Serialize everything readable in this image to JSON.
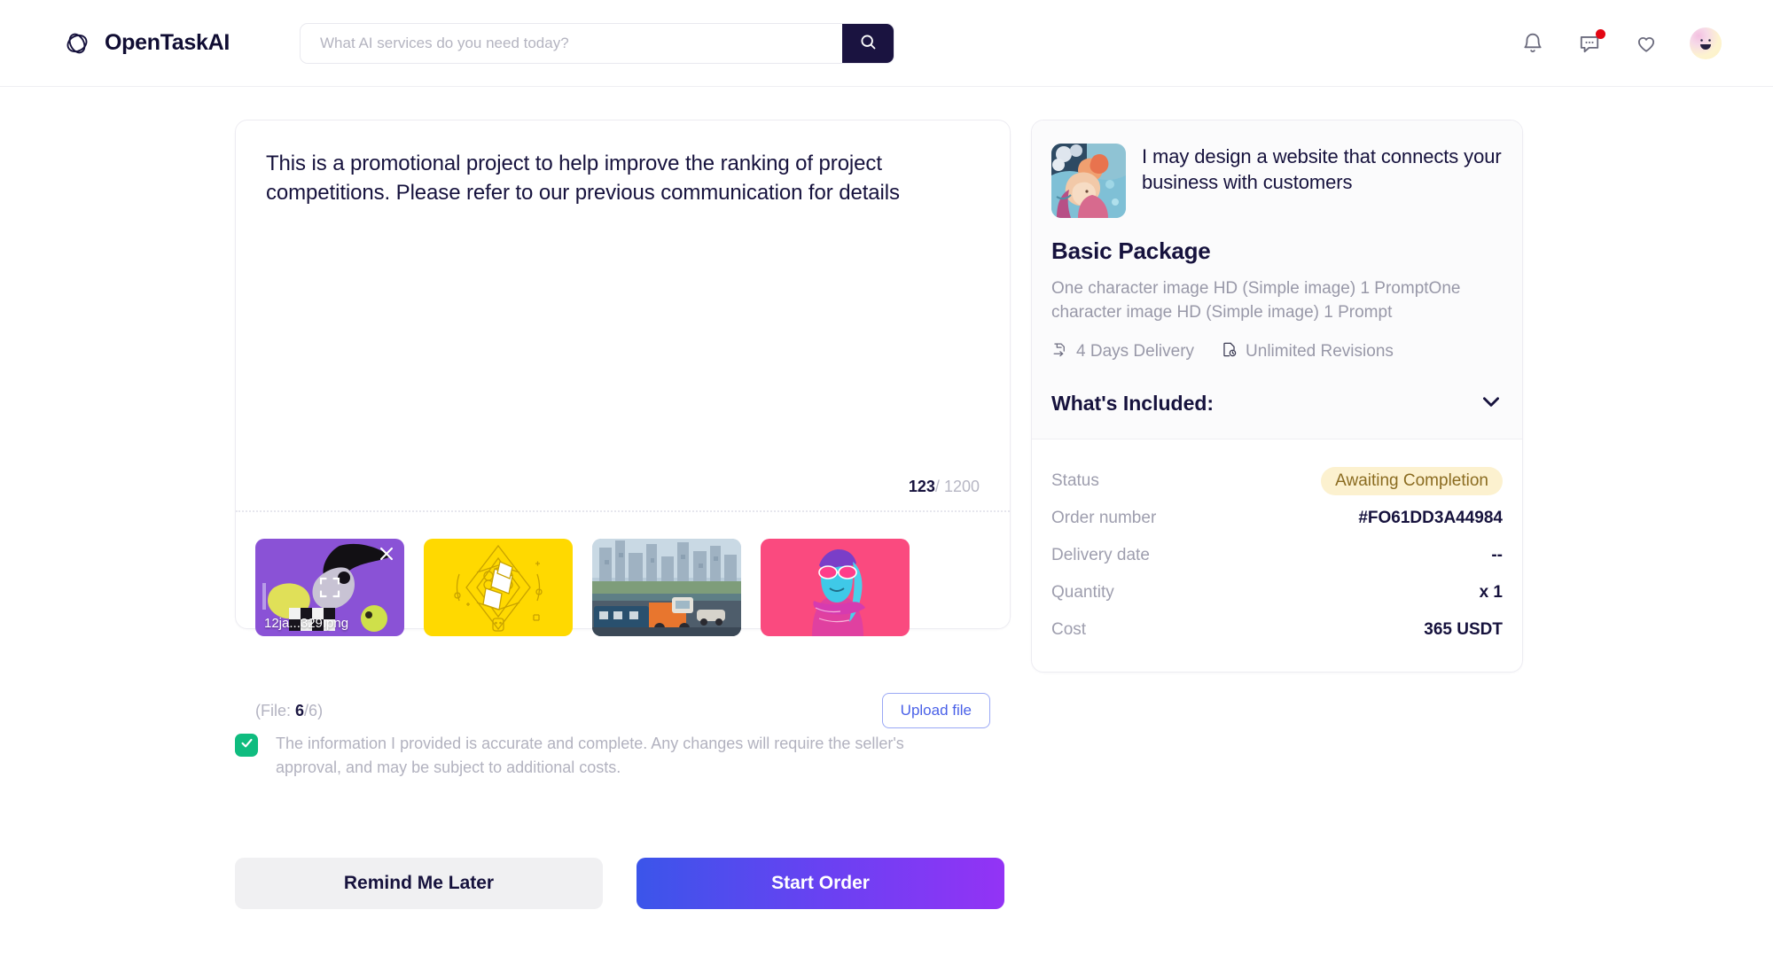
{
  "header": {
    "brand": "OpenTaskAI",
    "logo_icon": "hexagon-loop-logo-icon",
    "search": {
      "placeholder": "What AI services do you need today?",
      "value": "",
      "button_icon": "search-icon"
    },
    "icons": {
      "notifications": "bell-icon",
      "messages": "chat-bubble-icon",
      "favorites": "heart-icon",
      "avatar": "user-avatar-smiley"
    },
    "message_badge": true,
    "badge_color": "#e30613"
  },
  "brief": {
    "text": "This is a promotional project to help improve the ranking of project competitions. Please refer to our previous communication for details",
    "char_count": "123",
    "char_limit_separator": "/",
    "char_limit": "1200"
  },
  "attachments": {
    "files": [
      {
        "name": "12ja...329.png",
        "selected": true,
        "close_icon": "close-x-icon",
        "expand_icon": "expand-icon",
        "theme": "purple-chess-illustration"
      },
      {
        "name": "",
        "selected": false,
        "theme": "yellow-diamond-line-art"
      },
      {
        "name": "",
        "selected": false,
        "theme": "city-street-painting"
      },
      {
        "name": "",
        "selected": false,
        "theme": "pink-portrait-neon"
      }
    ],
    "count_prefix": "(File:",
    "count_current": "6",
    "count_sep": "/",
    "count_max": "6",
    "count_suffix": ")",
    "upload_label": "Upload file"
  },
  "consent": {
    "checked": true,
    "check_icon": "checkmark-icon",
    "check_color": "#0fbc7f",
    "text": "The information I provided is accurate and complete. Any changes will require the seller's approval, and may be subject to additional costs."
  },
  "actions": {
    "secondary_label": "Remind Me Later",
    "primary_label": "Start Order",
    "primary_gradient_from": "#3b55ea",
    "primary_gradient_to": "#9333f5"
  },
  "package": {
    "thumbnail": "fantasy-portrait-artwork",
    "service_title": "I may design a website that connects your business with customers",
    "name": "Basic Package",
    "description": "One character image HD (Simple image) 1 PromptOne character image HD (Simple image) 1 Prompt",
    "delivery_icon": "delivery-time-icon",
    "delivery": "4 Days Delivery",
    "revisions_icon": "revision-file-icon",
    "revisions": "Unlimited Revisions",
    "included_label": "What's Included:",
    "included_expanded": false,
    "included_chevron": "chevron-down-icon"
  },
  "order": {
    "rows": [
      {
        "label": "Status",
        "value": "Awaiting Completion",
        "type": "badge"
      },
      {
        "label": "Order number",
        "value": "#FO61DD3A44984",
        "type": "text"
      },
      {
        "label": "Delivery date",
        "value": "--",
        "type": "text"
      },
      {
        "label": "Quantity",
        "value": "x 1",
        "type": "text"
      },
      {
        "label": "Cost",
        "value": "365 USDT",
        "type": "text"
      }
    ],
    "status_bg": "#fcf1cf",
    "status_fg": "#8b6c21"
  }
}
